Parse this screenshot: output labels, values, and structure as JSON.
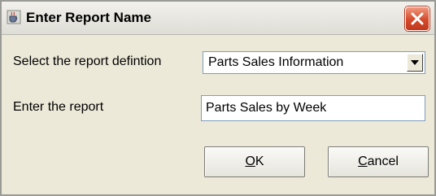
{
  "dialog": {
    "title": "Enter Report Name",
    "icons": {
      "app": "coffee-cup-icon",
      "close": "close-icon",
      "dropdown": "chevron-down-icon"
    },
    "colors": {
      "close_button": "#d44a2b",
      "window_bg": "#ece9d8",
      "field_border": "#7f9db9"
    }
  },
  "form": {
    "definition_label": "Select the report defintion",
    "definition_value": "Parts Sales Information",
    "report_label": "Enter the report",
    "report_value": "Parts Sales by Week"
  },
  "buttons": {
    "ok_mnemonic": "O",
    "ok_rest": "K",
    "cancel_mnemonic": "C",
    "cancel_rest": "ancel"
  }
}
